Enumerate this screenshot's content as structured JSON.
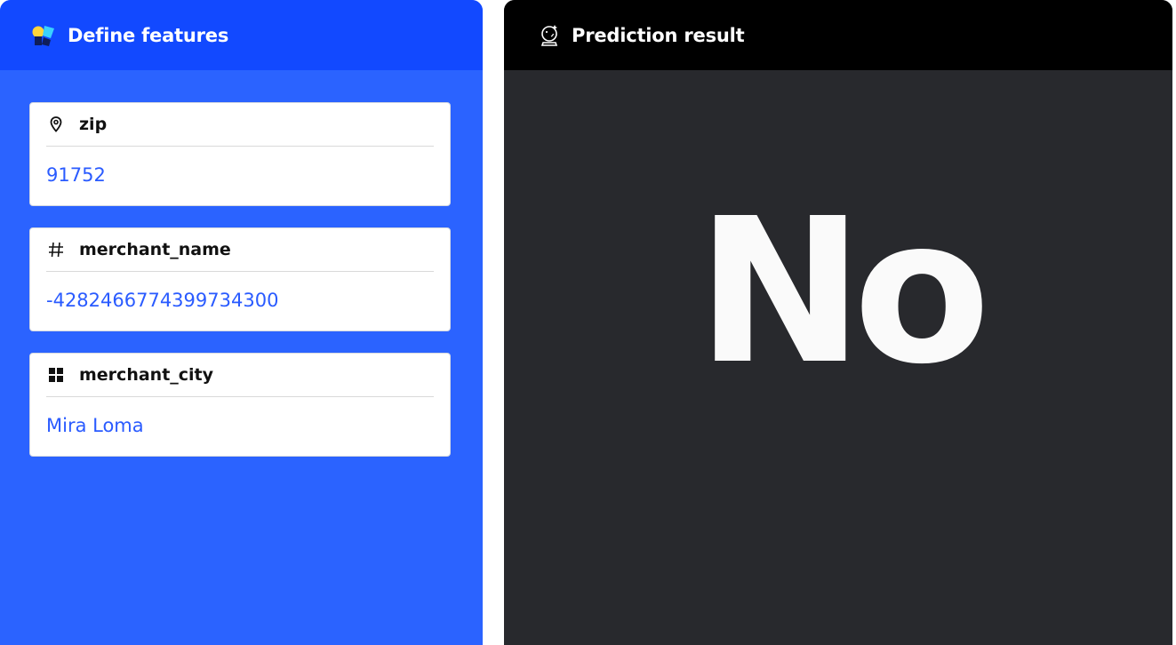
{
  "left_panel": {
    "title": "Define features",
    "icon": "app-logo-icon",
    "features": [
      {
        "icon": "map-pin-icon",
        "label": "zip",
        "value": "91752"
      },
      {
        "icon": "hash-icon",
        "label": "merchant_name",
        "value": "-4282466774399734300"
      },
      {
        "icon": "grid-icon",
        "label": "merchant_city",
        "value": "Mira Loma"
      }
    ]
  },
  "right_panel": {
    "title": "Prediction result",
    "icon": "crystal-ball-icon",
    "result": "No"
  },
  "colors": {
    "left_bg": "#2b63ff",
    "left_header": "#1249ff",
    "right_bg": "#28292d",
    "right_header": "#000000",
    "value_text": "#2a5bff"
  }
}
